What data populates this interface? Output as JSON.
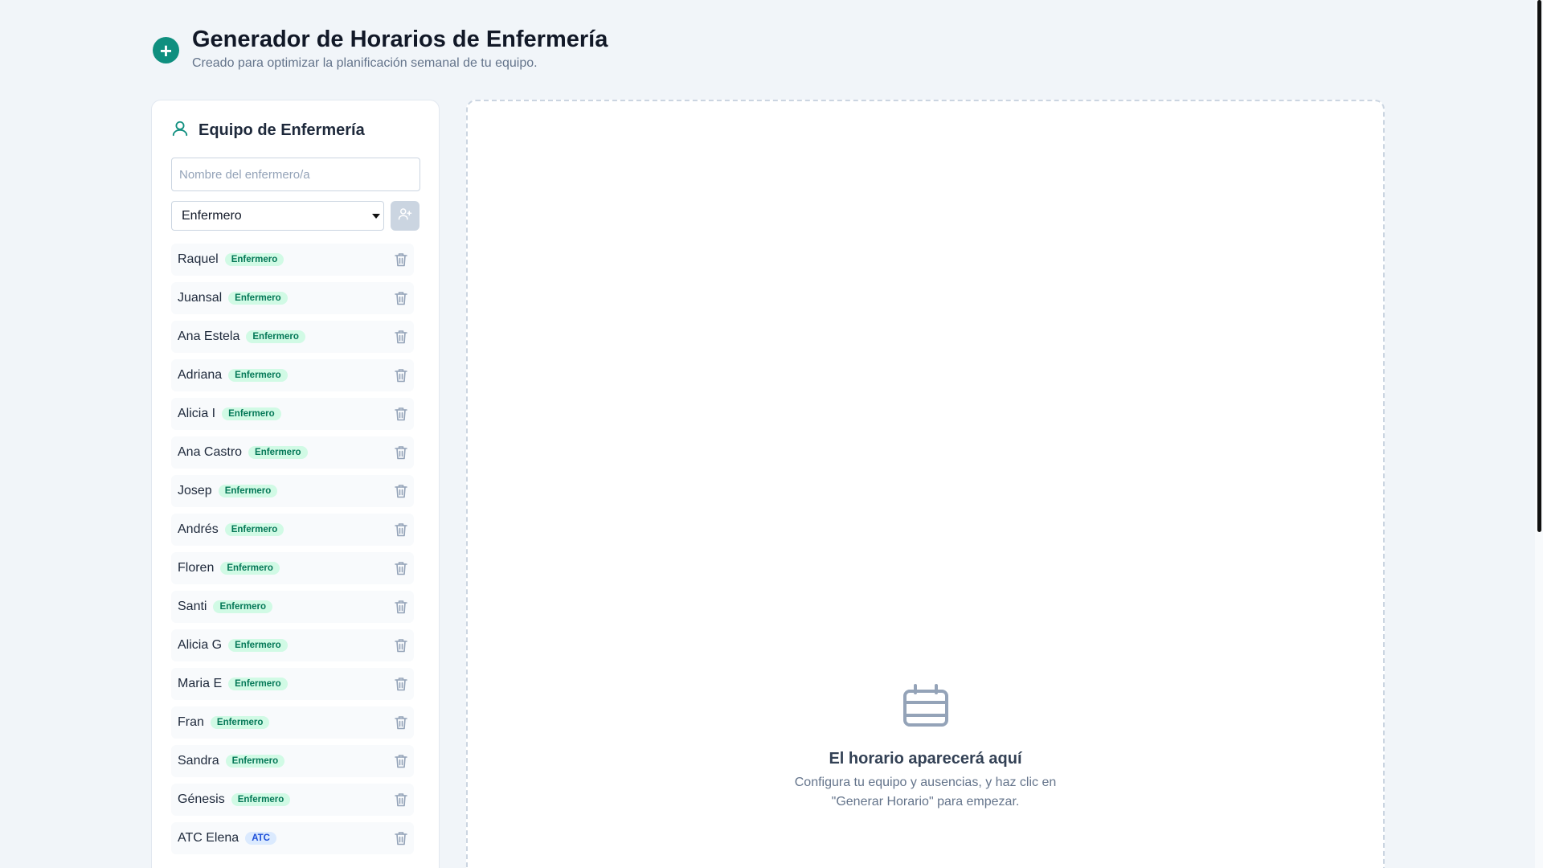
{
  "app": {
    "title": "Generador de Horarios de Enfermería",
    "subtitle": "Creado para optimizar la planificación semanal de tu equipo."
  },
  "sidebar": {
    "title": "Equipo de Enfermería",
    "name_input": {
      "placeholder": "Nombre del enfermero/a",
      "value": ""
    },
    "role_select": {
      "selected": "Enfermero"
    },
    "nurses": [
      {
        "name": "Raquel",
        "role": "Enfermero"
      },
      {
        "name": "Juansal",
        "role": "Enfermero"
      },
      {
        "name": "Ana Estela",
        "role": "Enfermero"
      },
      {
        "name": "Adriana",
        "role": "Enfermero"
      },
      {
        "name": "Alicia I",
        "role": "Enfermero"
      },
      {
        "name": "Ana Castro",
        "role": "Enfermero"
      },
      {
        "name": "Josep",
        "role": "Enfermero"
      },
      {
        "name": "Andrés",
        "role": "Enfermero"
      },
      {
        "name": "Floren",
        "role": "Enfermero"
      },
      {
        "name": "Santi",
        "role": "Enfermero"
      },
      {
        "name": "Alicia G",
        "role": "Enfermero"
      },
      {
        "name": "Maria E",
        "role": "Enfermero"
      },
      {
        "name": "Fran",
        "role": "Enfermero"
      },
      {
        "name": "Sandra",
        "role": "Enfermero"
      },
      {
        "name": "Génesis",
        "role": "Enfermero"
      },
      {
        "name": "ATC Elena",
        "role": "ATC"
      }
    ]
  },
  "main": {
    "empty_title": "El horario aparecerá aquí",
    "empty_desc": "Configura tu equipo y ausencias, y haz clic en \"Generar Horario\" para empezar."
  },
  "colors": {
    "accent": "#0f8f7f",
    "badge_enfermero_bg": "#d1fae5",
    "badge_enfermero_text": "#047857",
    "badge_atc_bg": "#dbeafe",
    "badge_atc_text": "#1d4ed8"
  }
}
